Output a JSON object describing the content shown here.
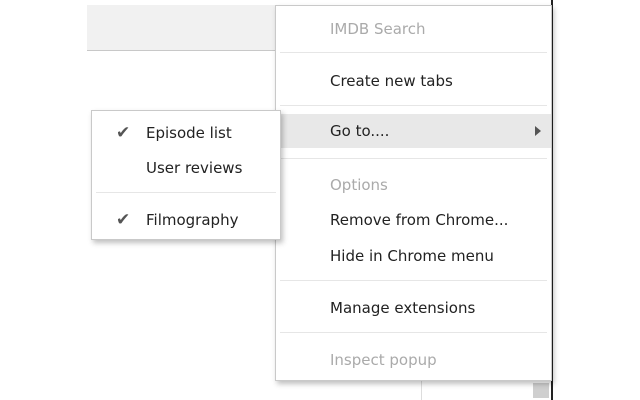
{
  "main_menu": {
    "title": "IMDB Search",
    "create_tabs": "Create new tabs",
    "go_to": "Go to....",
    "options": "Options",
    "remove": "Remove from Chrome...",
    "hide": "Hide in Chrome menu",
    "manage": "Manage extensions",
    "inspect": "Inspect popup"
  },
  "submenu": {
    "items": [
      {
        "label": "Episode list",
        "checked": true,
        "check": "✔"
      },
      {
        "label": "User reviews",
        "checked": false
      },
      {
        "label": "Filmography",
        "checked": true,
        "check": "✔"
      }
    ]
  }
}
